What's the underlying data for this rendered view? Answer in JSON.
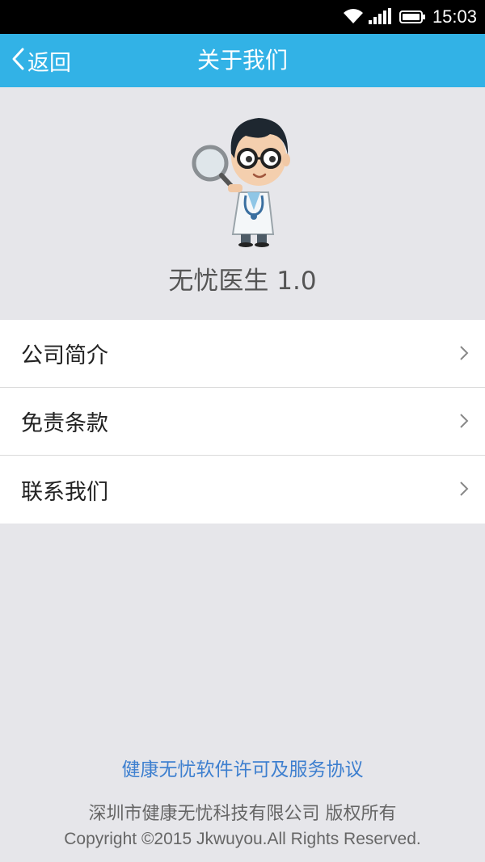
{
  "status_bar": {
    "time": "15:03"
  },
  "nav": {
    "back_label": "返回",
    "title": "关于我们"
  },
  "hero": {
    "app_name": "无忧医生 1.0"
  },
  "menu": {
    "items": [
      {
        "label": "公司简介"
      },
      {
        "label": "免责条款"
      },
      {
        "label": "联系我们"
      }
    ]
  },
  "footer": {
    "agreement_link": "健康无忧软件许可及服务协议",
    "company": "深圳市健康无忧科技有限公司 版权所有",
    "copyright": "Copyright ©2015 Jkwuyou.All Rights Reserved."
  },
  "colors": {
    "nav_bg": "#32b2e6",
    "page_bg": "#e6e6ea",
    "link": "#3d7fcf"
  }
}
